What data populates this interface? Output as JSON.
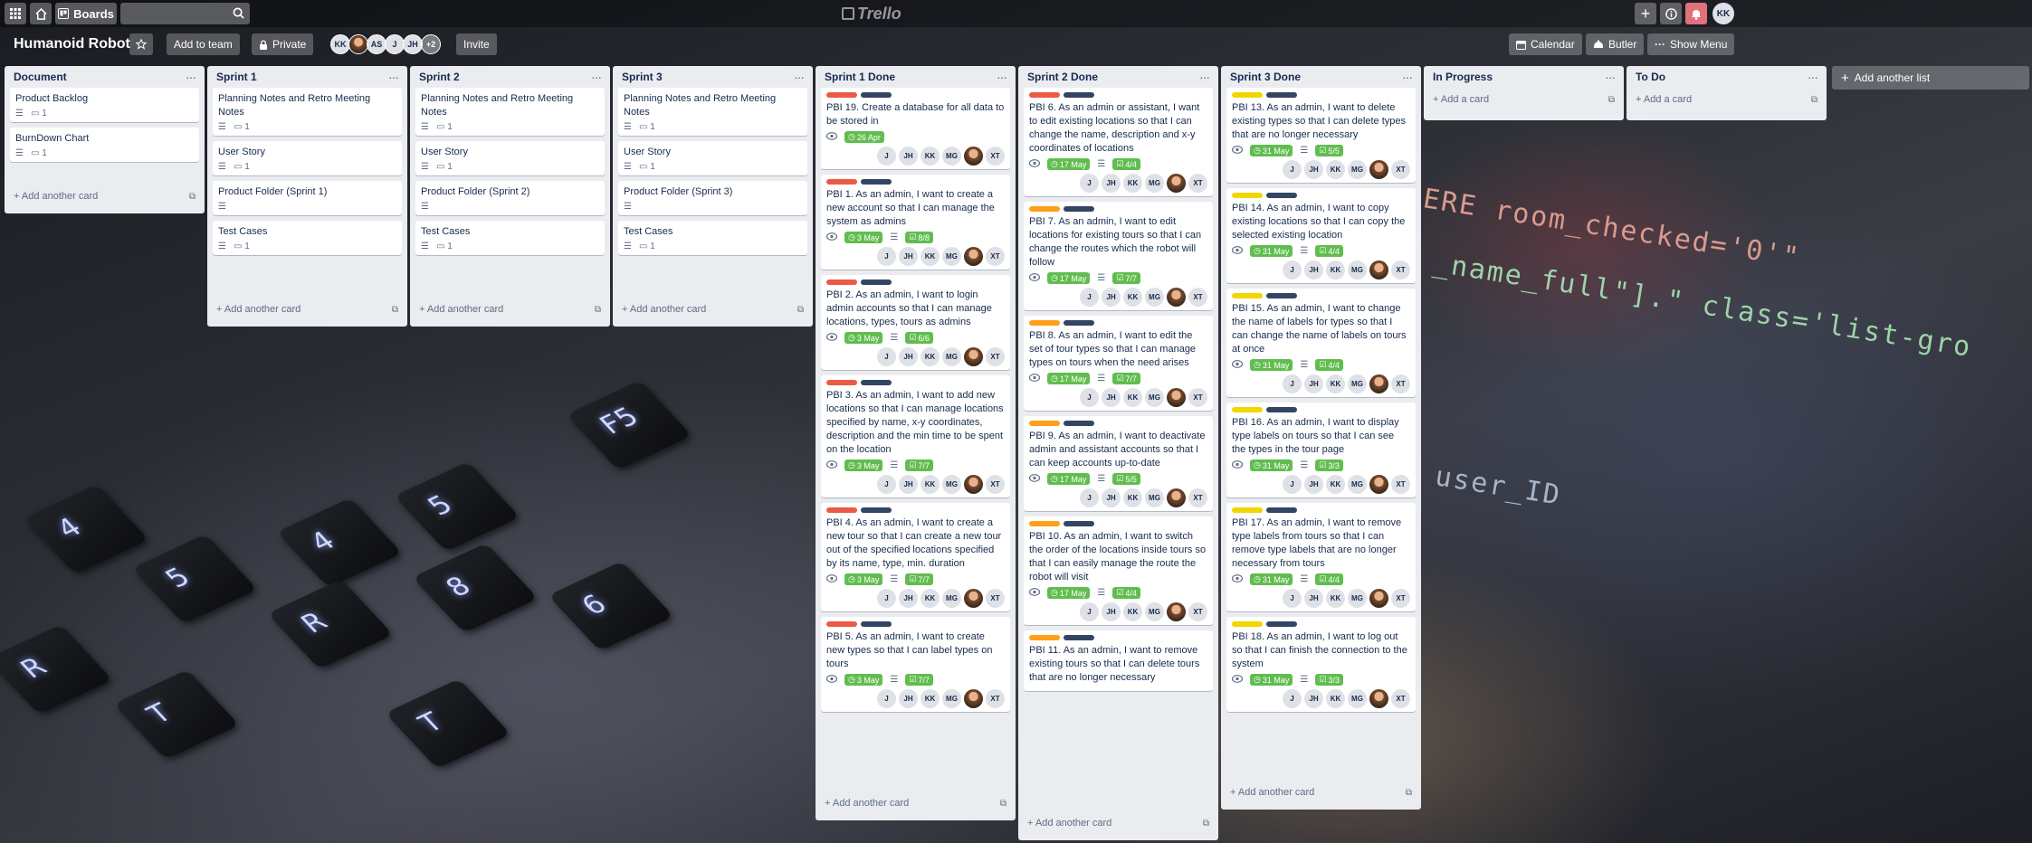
{
  "header": {
    "boards_label": "Boards",
    "logo_text": "Trello",
    "user_initials": "KK"
  },
  "board": {
    "title": "Humanoid Robot",
    "add_to_team": "Add to team",
    "visibility": "Private",
    "invite": "Invite",
    "calendar": "Calendar",
    "butler": "Butler",
    "show_menu": "Show Menu",
    "members": [
      "KK",
      "",
      "AS",
      "J",
      "JH"
    ],
    "more_members": "+2"
  },
  "add_list_label": "Add another list",
  "add_card_label": "Add another card",
  "add_a_card_label": "Add a card",
  "member_initials": [
    "J",
    "JH",
    "KK",
    "MG",
    "",
    "XT"
  ],
  "lists": [
    {
      "title": "Document",
      "cards": [
        {
          "title": "Product Backlog",
          "comments": "1"
        },
        {
          "title": "BurnDown Chart",
          "comments": "1"
        }
      ]
    },
    {
      "title": "Sprint 1",
      "cards": [
        {
          "title": "Planning Notes and Retro Meeting Notes",
          "comments": "1"
        },
        {
          "title": "User Story",
          "comments": "1"
        },
        {
          "title": "Product Folder (Sprint 1)",
          "comments": ""
        },
        {
          "title": "Test Cases",
          "comments": "1"
        }
      ]
    },
    {
      "title": "Sprint 2",
      "cards": [
        {
          "title": "Planning Notes and Retro Meeting Notes",
          "comments": "1"
        },
        {
          "title": "User Story",
          "comments": "1"
        },
        {
          "title": "Product Folder (Sprint 2)",
          "comments": ""
        },
        {
          "title": "Test Cases",
          "comments": "1"
        }
      ]
    },
    {
      "title": "Sprint 3",
      "cards": [
        {
          "title": "Planning Notes and Retro Meeting Notes",
          "comments": "1"
        },
        {
          "title": "User Story",
          "comments": "1"
        },
        {
          "title": "Product Folder (Sprint 3)",
          "comments": ""
        },
        {
          "title": "Test Cases",
          "comments": "1"
        }
      ]
    },
    {
      "title": "Sprint 1 Done",
      "cards": [
        {
          "title": "PBI 19. Create a database for all data to be stored in",
          "due": "26 Apr",
          "checklist": ""
        },
        {
          "title": "PBI 1. As an admin, I want to create a new account so that I can manage the system as admins",
          "due": "3 May",
          "checklist": "8/8"
        },
        {
          "title": "PBI 2. As an admin, I want to login admin accounts so that I can manage locations, types, tours as admins",
          "due": "3 May",
          "checklist": "6/6"
        },
        {
          "title": "PBI 3. As an admin, I want to add new locations so that I can manage locations specified by name, x-y coordinates, description and the min time to be spent on the location",
          "due": "3 May",
          "checklist": "7/7"
        },
        {
          "title": "PBI 4. As an admin, I want to create a new tour so that I can create a new tour out of the specified locations specified by its name, type, min. duration",
          "due": "3 May",
          "checklist": "7/7"
        },
        {
          "title": "PBI 5. As an admin, I want to create new types so that I can label types on tours",
          "due": "3 May",
          "checklist": "7/7"
        }
      ]
    },
    {
      "title": "Sprint 2 Done",
      "cards": [
        {
          "title": "PBI 6. As an admin or assistant, I want to edit existing locations so that I can change the name, description and x-y coordinates of locations",
          "due": "17 May",
          "checklist": "4/4"
        },
        {
          "title": "PBI 7. As an admin, I want to edit locations for existing tours so that I can change the routes which the robot will follow",
          "due": "17 May",
          "checklist": "7/7"
        },
        {
          "title": "PBI 8. As an admin, I want to edit the set of tour types so that I can manage types on tours when the need arises",
          "due": "17 May",
          "checklist": "7/7"
        },
        {
          "title": "PBI 9. As an admin, I want to deactivate admin and assistant accounts so that I can keep accounts up-to-date",
          "due": "17 May",
          "checklist": "5/5"
        },
        {
          "title": "PBI 10. As an admin, I want to switch the order of the locations inside tours so that I can easily manage the route the robot will visit",
          "due": "17 May",
          "checklist": "4/4"
        },
        {
          "title": "PBI 11. As an admin, I want to remove existing tours so that I can delete tours that are no longer necessary",
          "due": "",
          "checklist": ""
        }
      ]
    },
    {
      "title": "Sprint 3 Done",
      "cards": [
        {
          "title": "PBI 13. As an admin, I want to delete existing types so that I can delete types that are no longer necessary",
          "due": "31 May",
          "checklist": "5/5"
        },
        {
          "title": "PBI 14. As an admin, I want to copy existing locations so that I can copy the selected existing location",
          "due": "31 May",
          "checklist": "4/4"
        },
        {
          "title": "PBI 15. As an admin, I want to change the name of labels for types so that I can change the name of labels on tours at once",
          "due": "31 May",
          "checklist": "4/4"
        },
        {
          "title": "PBI 16. As an admin, I want to display type labels on tours so that I can see the types in the tour page",
          "due": "31 May",
          "checklist": "3/3"
        },
        {
          "title": "PBI 17. As an admin, I want to remove type labels from tours so that I can remove type labels that are no longer necessary from tours",
          "due": "31 May",
          "checklist": "4/4"
        },
        {
          "title": "PBI 18. As an admin, I want to log out so that I can finish the connection to the system",
          "due": "31 May",
          "checklist": "3/3"
        }
      ]
    },
    {
      "title": "In Progress",
      "cards": []
    },
    {
      "title": "To Do",
      "cards": []
    }
  ],
  "colors": {
    "red_label": "#eb5a46",
    "navy_label": "#344563",
    "orange_label": "#ff9f1a",
    "yellow_label": "#f2d600",
    "green_badge": "#61bd4f",
    "list_bg": "#ebecf0"
  },
  "background_code": [
    "ERE room_checked='0'\"",
    "_name_full\"].\" class='list-gro",
    "user_ID"
  ],
  "background_keys": [
    "4",
    "5",
    "R",
    "T",
    "6",
    "8",
    "5",
    "4",
    "R",
    "T",
    "F5"
  ]
}
